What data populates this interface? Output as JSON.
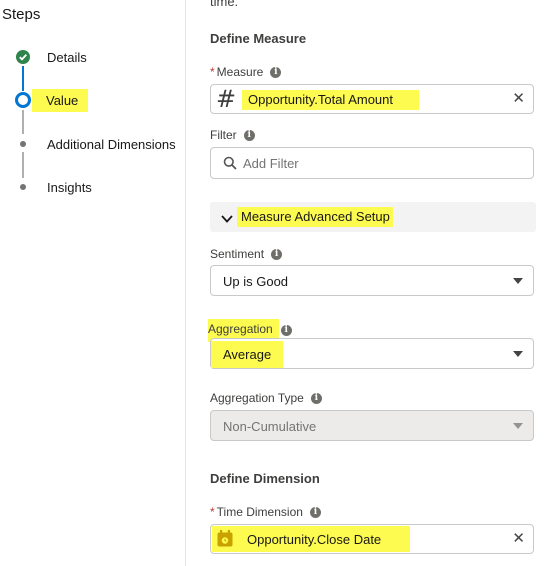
{
  "steps": {
    "title": "Steps",
    "items": [
      {
        "label": "Details",
        "state": "complete"
      },
      {
        "label": "Value",
        "state": "active"
      },
      {
        "label": "Additional Dimensions",
        "state": "pending"
      },
      {
        "label": "Insights",
        "state": "pending"
      }
    ]
  },
  "form": {
    "top_cut_text": "time.",
    "define_measure": {
      "heading": "Define Measure",
      "measure": {
        "required_mark": "*",
        "label": "Measure",
        "value": "Opportunity.Total Amount",
        "icon": "hash-icon"
      },
      "filter": {
        "label": "Filter",
        "placeholder": "Add Filter"
      },
      "advanced_setup": {
        "label": "Measure Advanced Setup",
        "expanded": true
      },
      "sentiment": {
        "label": "Sentiment",
        "value": "Up is Good"
      },
      "aggregation": {
        "label": "Aggregation",
        "value": "Average"
      },
      "aggregation_type": {
        "label": "Aggregation Type",
        "value": "Non-Cumulative",
        "disabled": true
      }
    },
    "define_dimension": {
      "heading": "Define Dimension",
      "time_dimension": {
        "required_mark": "*",
        "label": "Time Dimension",
        "value": "Opportunity.Close Date",
        "icon": "calendar-icon"
      }
    }
  },
  "colors": {
    "highlight": "#fdfa50",
    "accent_blue": "#0176d3",
    "complete_green": "#2e844a",
    "calendar_yellow": "#c9a200"
  }
}
